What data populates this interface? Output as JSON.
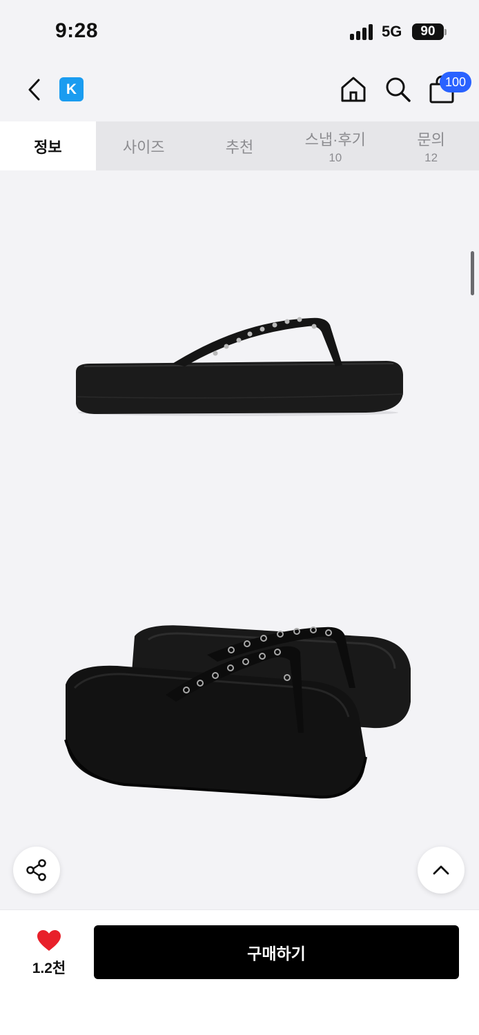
{
  "status": {
    "time": "9:28",
    "network": "5G",
    "battery": "90"
  },
  "nav": {
    "logo": "K",
    "cart_count": "100"
  },
  "tabs": [
    {
      "label": "정보",
      "count": ""
    },
    {
      "label": "사이즈",
      "count": ""
    },
    {
      "label": "추천",
      "count": ""
    },
    {
      "label": "스냅·후기",
      "count": "10"
    },
    {
      "label": "문의",
      "count": "12"
    }
  ],
  "bottom": {
    "like_count": "1.2천",
    "buy_label": "구매하기"
  },
  "colors": {
    "accent": "#2962ff",
    "logo": "#1a9cf0",
    "like": "#e8202a",
    "buy": "#000000"
  },
  "icons": [
    "back-icon",
    "home-icon",
    "search-icon",
    "shopping-bag-icon",
    "share-icon",
    "chevron-up-icon",
    "heart-icon"
  ]
}
